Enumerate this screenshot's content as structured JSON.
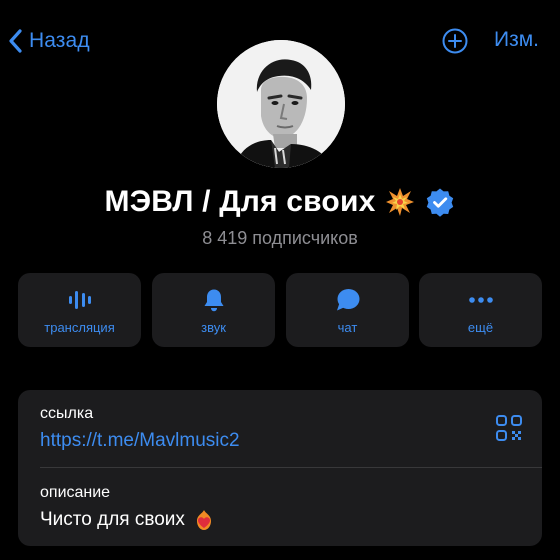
{
  "nav": {
    "back_label": "Назад",
    "edit_label": "Изм."
  },
  "channel": {
    "title": "МЭВЛ / Для своих",
    "subscribers": "8 419 подписчиков",
    "verified": true
  },
  "actions": [
    {
      "label": "трансляция",
      "icon": "audio-wave-icon"
    },
    {
      "label": "звук",
      "icon": "bell-icon"
    },
    {
      "label": "чат",
      "icon": "chat-bubble-icon"
    },
    {
      "label": "ещё",
      "icon": "more-dots-icon"
    }
  ],
  "info": {
    "link_label": "ссылка",
    "link_value": "https://t.me/Mavlmusic2",
    "description_label": "описание",
    "description_value": "Чисто для своих"
  },
  "colors": {
    "background": "#000000",
    "card": "#1c1c1e",
    "accent": "#3d8cf0",
    "secondary_text": "#8e8e93"
  }
}
